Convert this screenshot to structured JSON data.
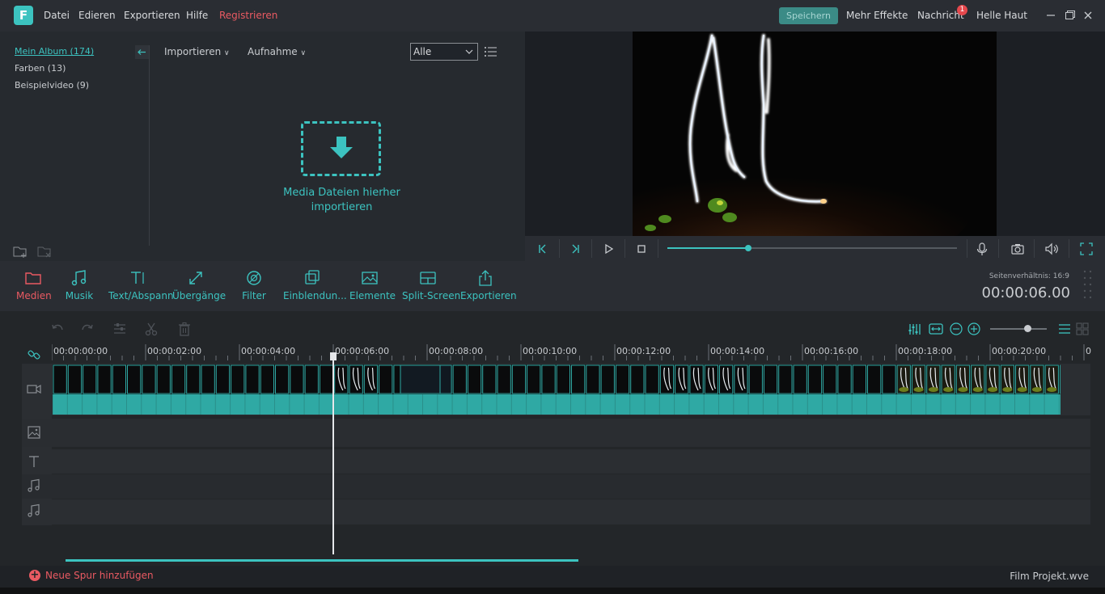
{
  "app": {
    "logo_letter": "F",
    "menu": [
      "Datei",
      "Edieren",
      "Exportieren",
      "Hilfe"
    ],
    "register_label": "Registrieren",
    "save_label": "Speichern",
    "more_effects_label": "Mehr Effekte",
    "message_label": "Nachricht",
    "message_badge": "1",
    "skin_label": "Helle Haut",
    "accent_color": "#3cc3c0",
    "alert_color": "#ea5a62"
  },
  "media": {
    "albums": [
      {
        "label": "Mein Album (174)",
        "active": true
      },
      {
        "label": "Farben (13)",
        "active": false
      },
      {
        "label": "Beispielvideo (9)",
        "active": false
      }
    ],
    "import_dropdown": "Importieren",
    "record_dropdown": "Aufnahme",
    "filter_value": "Alle",
    "drop_text_line1": "Media Dateien hierher",
    "drop_text_line2": "importieren"
  },
  "player": {
    "progress": 0.28
  },
  "toolbar": {
    "tools": [
      {
        "label": "Medien",
        "icon": "folder-icon"
      },
      {
        "label": "Musik",
        "icon": "music-note-icon"
      },
      {
        "label": "Text/Abspann",
        "icon": "text-icon"
      },
      {
        "label": "Übergänge",
        "icon": "transition-icon"
      },
      {
        "label": "Filter",
        "icon": "filter-icon"
      },
      {
        "label": "Einblendun...",
        "icon": "overlay-icon"
      },
      {
        "label": "Elemente",
        "icon": "image-icon"
      },
      {
        "label": "Split-Screen",
        "icon": "split-screen-icon"
      },
      {
        "label": "Exportieren",
        "icon": "export-icon"
      }
    ],
    "aspect_ratio": "Seitenverhältnis: 16:9",
    "timecode": "00:00:06.00"
  },
  "timeline": {
    "ruler": [
      "00:00:00:00",
      "00:00:02:00",
      "00:00:04:00",
      "00:00:06:00",
      "00:00:08:00",
      "00:00:10:00",
      "00:00:12:00",
      "00:00:14:00",
      "00:00:16:00",
      "00:00:18:00",
      "00:00:20:00",
      "0"
    ],
    "zoom_level": 0.65,
    "add_track_label": "Neue Spur hinzufügen",
    "project_name": "Film Projekt.wve"
  }
}
